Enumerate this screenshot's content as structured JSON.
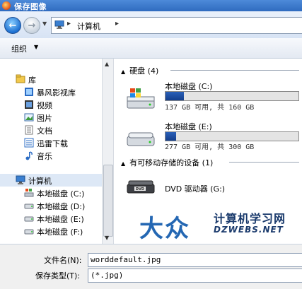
{
  "window": {
    "title": "保存图像"
  },
  "address": {
    "crumb": "计算机",
    "sep": "▸"
  },
  "toolbar": {
    "organize": "组织",
    "organize_arrow": "▼"
  },
  "sidebar": {
    "items": [
      {
        "label": "库",
        "icon": "library-icon"
      },
      {
        "label": "暴风影视库",
        "icon": "video-library-icon"
      },
      {
        "label": "视频",
        "icon": "video-icon"
      },
      {
        "label": "图片",
        "icon": "picture-icon"
      },
      {
        "label": "文档",
        "icon": "document-icon"
      },
      {
        "label": "迅雷下载",
        "icon": "download-icon"
      },
      {
        "label": "音乐",
        "icon": "music-icon"
      },
      {
        "label": "计算机",
        "icon": "computer-icon"
      },
      {
        "label": "本地磁盘 (C:)",
        "icon": "drive-c-icon"
      },
      {
        "label": "本地磁盘 (D:)",
        "icon": "drive-icon"
      },
      {
        "label": "本地磁盘 (E:)",
        "icon": "drive-icon"
      },
      {
        "label": "本地磁盘 (F:)",
        "icon": "drive-icon"
      }
    ]
  },
  "main": {
    "groups": [
      {
        "title": "硬盘 (4)"
      },
      {
        "title": "有可移动存储的设备 (1)"
      }
    ],
    "drives": [
      {
        "name": "本地磁盘 (C:)",
        "size": "137 GB 可用, 共 160 GB",
        "used_fraction": 0.14
      },
      {
        "name": "本地磁盘 (E:)",
        "size": "277 GB 可用, 共 300 GB",
        "used_fraction": 0.08
      },
      {
        "name": "DVD 驱动器 (G:)"
      }
    ]
  },
  "watermark": {
    "brand": "大众",
    "site_cn": "计算机学习网",
    "site_en": "DZWEBS.NET"
  },
  "form": {
    "filename_label": "文件名(N):",
    "filename_value": "worddefault.jpg",
    "filetype_label": "保存类型(T):",
    "filetype_value": " (*.jpg)"
  },
  "colors": {
    "titlebar": "#2f6bbf",
    "accent": "#2467b3",
    "drive_bar": "#1c4a9e"
  }
}
